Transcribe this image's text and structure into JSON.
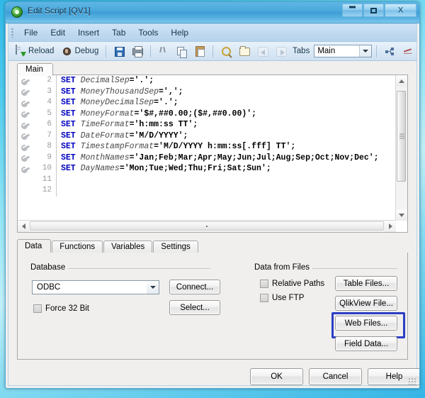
{
  "window": {
    "title": "Edit Script [QV1]",
    "icon": "qlikview-logo-icon",
    "minimize": "",
    "maximize": "",
    "close": "X"
  },
  "menu": {
    "items": [
      {
        "label": "File"
      },
      {
        "label": "Edit"
      },
      {
        "label": "Insert"
      },
      {
        "label": "Tab"
      },
      {
        "label": "Tools"
      },
      {
        "label": "Help"
      }
    ]
  },
  "toolbar": {
    "reload_label": "Reload",
    "debug_label": "Debug",
    "tabs_label": "Tabs",
    "tab_combo_value": "Main"
  },
  "editor": {
    "tab_label": "Main",
    "lines": [
      {
        "num": "2",
        "kw": "SET ",
        "var": "DecimalSep",
        "lit": "='.';"
      },
      {
        "num": "3",
        "kw": "SET ",
        "var": "MoneyThousandSep",
        "lit": "=',';"
      },
      {
        "num": "4",
        "kw": "SET ",
        "var": "MoneyDecimalSep",
        "lit": "='.';"
      },
      {
        "num": "5",
        "kw": "SET ",
        "var": "MoneyFormat",
        "lit": "='$#,##0.00;($#,##0.00)';"
      },
      {
        "num": "6",
        "kw": "SET ",
        "var": "TimeFormat",
        "lit": "='h:mm:ss TT';"
      },
      {
        "num": "7",
        "kw": "SET ",
        "var": "DateFormat",
        "lit": "='M/D/YYYY';"
      },
      {
        "num": "8",
        "kw": "SET ",
        "var": "TimestampFormat",
        "lit": "='M/D/YYYY h:mm:ss[.fff] TT';"
      },
      {
        "num": "9",
        "kw": "SET ",
        "var": "MonthNames",
        "lit": "='Jan;Feb;Mar;Apr;May;Jun;Jul;Aug;Sep;Oct;Nov;Dec';"
      },
      {
        "num": "10",
        "kw": "SET ",
        "var": "DayNames",
        "lit": "='Mon;Tue;Wed;Thu;Fri;Sat;Sun';"
      },
      {
        "num": "11",
        "kw": "",
        "var": "",
        "lit": ""
      },
      {
        "num": "12",
        "kw": "",
        "var": "",
        "lit": ""
      }
    ]
  },
  "bottom_tabs": [
    {
      "label": "Data",
      "active": true
    },
    {
      "label": "Functions",
      "active": false
    },
    {
      "label": "Variables",
      "active": false
    },
    {
      "label": "Settings",
      "active": false
    }
  ],
  "database_group": {
    "label": "Database",
    "combo_value": "ODBC",
    "force32_label": "Force 32 Bit",
    "connect_label": "Connect...",
    "select_label": "Select..."
  },
  "files_group": {
    "label": "Data from Files",
    "relative_paths_label": "Relative Paths",
    "use_ftp_label": "Use FTP",
    "table_files_label": "Table Files...",
    "qlikview_file_label": "QlikView File...",
    "web_files_label": "Web Files...",
    "field_data_label": "Field Data...",
    "highlight_color": "#2b3fc4",
    "highlighted_button": "web_files"
  },
  "dialog_buttons": {
    "ok": "OK",
    "cancel": "Cancel",
    "help": "Help"
  }
}
